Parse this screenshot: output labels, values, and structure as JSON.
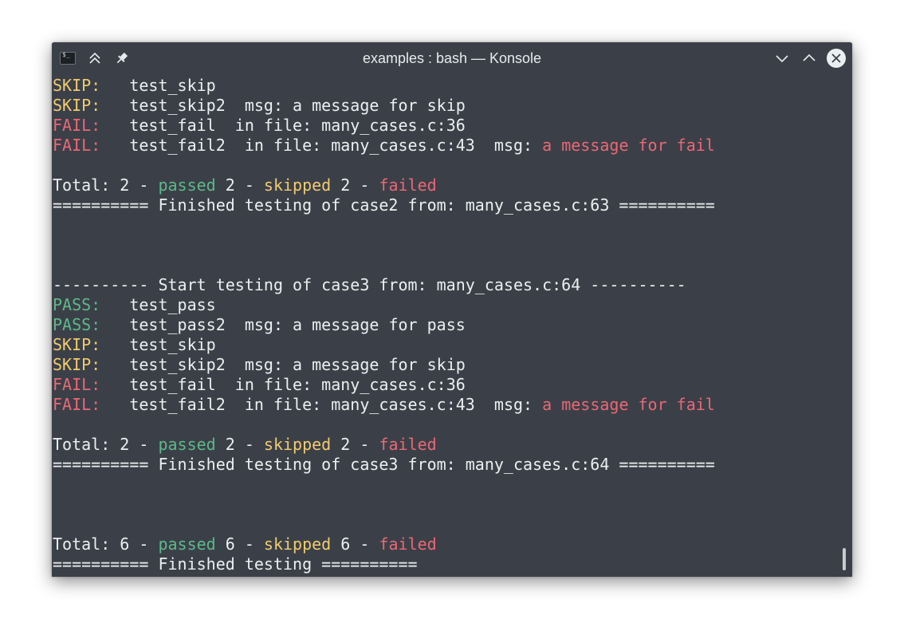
{
  "window": {
    "title": "examples : bash — Konsole",
    "icons": [
      "terminal-app-icon",
      "keep-above-icon",
      "pin-icon",
      "minimize-icon",
      "maximize-icon",
      "close-icon"
    ]
  },
  "colors": {
    "background": "#3b4048",
    "foreground": "#eceff1",
    "pass": "#5cb98a",
    "skip": "#f2cb6c",
    "fail": "#eb6776"
  },
  "terminal": {
    "lines": [
      {
        "segments": [
          {
            "text": "SKIP:",
            "color": "skip"
          },
          {
            "text": "   test_skip",
            "color": "fg"
          }
        ]
      },
      {
        "segments": [
          {
            "text": "SKIP:",
            "color": "skip"
          },
          {
            "text": "   test_skip2  msg: a message for skip",
            "color": "fg"
          }
        ]
      },
      {
        "segments": [
          {
            "text": "FAIL:",
            "color": "fail"
          },
          {
            "text": "   test_fail  in file: many_cases.c:36",
            "color": "fg"
          }
        ]
      },
      {
        "segments": [
          {
            "text": "FAIL:",
            "color": "fail"
          },
          {
            "text": "   test_fail2  in file: many_cases.c:43  msg: ",
            "color": "fg"
          },
          {
            "text": "a message for fail",
            "color": "fail"
          }
        ]
      },
      {
        "segments": []
      },
      {
        "segments": [
          {
            "text": "Total: 2 - ",
            "color": "fg"
          },
          {
            "text": "passed",
            "color": "pass"
          },
          {
            "text": " 2 - ",
            "color": "fg"
          },
          {
            "text": "skipped",
            "color": "skip"
          },
          {
            "text": " 2 - ",
            "color": "fg"
          },
          {
            "text": "failed",
            "color": "fail"
          }
        ]
      },
      {
        "segments": [
          {
            "text": "========== Finished testing of case2 from: many_cases.c:63 ==========",
            "color": "fg"
          }
        ]
      },
      {
        "segments": []
      },
      {
        "segments": []
      },
      {
        "segments": []
      },
      {
        "segments": [
          {
            "text": "---------- Start testing of case3 from: many_cases.c:64 ----------",
            "color": "fg"
          }
        ]
      },
      {
        "segments": [
          {
            "text": "PASS:",
            "color": "pass"
          },
          {
            "text": "   test_pass",
            "color": "fg"
          }
        ]
      },
      {
        "segments": [
          {
            "text": "PASS:",
            "color": "pass"
          },
          {
            "text": "   test_pass2  msg: a message for pass",
            "color": "fg"
          }
        ]
      },
      {
        "segments": [
          {
            "text": "SKIP:",
            "color": "skip"
          },
          {
            "text": "   test_skip",
            "color": "fg"
          }
        ]
      },
      {
        "segments": [
          {
            "text": "SKIP:",
            "color": "skip"
          },
          {
            "text": "   test_skip2  msg: a message for skip",
            "color": "fg"
          }
        ]
      },
      {
        "segments": [
          {
            "text": "FAIL:",
            "color": "fail"
          },
          {
            "text": "   test_fail  in file: many_cases.c:36",
            "color": "fg"
          }
        ]
      },
      {
        "segments": [
          {
            "text": "FAIL:",
            "color": "fail"
          },
          {
            "text": "   test_fail2  in file: many_cases.c:43  msg: ",
            "color": "fg"
          },
          {
            "text": "a message for fail",
            "color": "fail"
          }
        ]
      },
      {
        "segments": []
      },
      {
        "segments": [
          {
            "text": "Total: 2 - ",
            "color": "fg"
          },
          {
            "text": "passed",
            "color": "pass"
          },
          {
            "text": " 2 - ",
            "color": "fg"
          },
          {
            "text": "skipped",
            "color": "skip"
          },
          {
            "text": " 2 - ",
            "color": "fg"
          },
          {
            "text": "failed",
            "color": "fail"
          }
        ]
      },
      {
        "segments": [
          {
            "text": "========== Finished testing of case3 from: many_cases.c:64 ==========",
            "color": "fg"
          }
        ]
      },
      {
        "segments": []
      },
      {
        "segments": []
      },
      {
        "segments": []
      },
      {
        "segments": [
          {
            "text": "Total: 6 - ",
            "color": "fg"
          },
          {
            "text": "passed",
            "color": "pass"
          },
          {
            "text": " 6 - ",
            "color": "fg"
          },
          {
            "text": "skipped",
            "color": "skip"
          },
          {
            "text": " 6 - ",
            "color": "fg"
          },
          {
            "text": "failed",
            "color": "fail"
          }
        ]
      },
      {
        "segments": [
          {
            "text": "========== Finished testing ==========",
            "color": "fg"
          }
        ]
      }
    ]
  }
}
